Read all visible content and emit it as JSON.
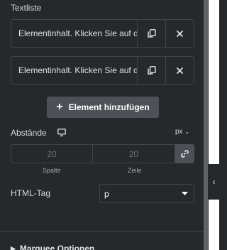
{
  "section": {
    "title": "Textliste"
  },
  "repeater": {
    "items": [
      {
        "label": "Elementinhalt. Klicken Sie auf das Element, um es zu bearbeiten."
      },
      {
        "label": "Elementinhalt. Klicken Sie auf das Element, um es zu bearbeiten."
      }
    ],
    "duplicate_icon": "copy-icon",
    "remove_icon": "close-icon",
    "add_label": "Element hinzufügen",
    "add_icon": "plus-icon"
  },
  "spacing": {
    "label": "Abstände",
    "device_icon": "desktop-icon",
    "unit": "px",
    "column_value": "20",
    "row_value": "20",
    "column_label": "Spalte",
    "row_label": "Zeile",
    "link_icon": "link-icon"
  },
  "html_tag": {
    "label": "HTML-Tag",
    "value": "p"
  },
  "next_section": {
    "label": "Marquee Optionen"
  },
  "colors": {
    "panel_bg": "#26292c",
    "border": "#404349",
    "button_bg": "#4b5157",
    "text": "#d5d8dc"
  }
}
